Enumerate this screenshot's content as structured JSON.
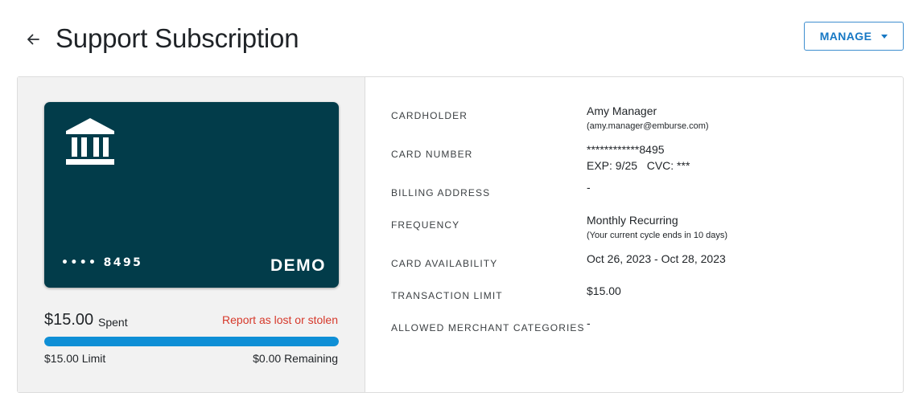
{
  "header": {
    "title": "Support Subscription",
    "back_icon": "arrow-left-icon",
    "manage_label": "MANAGE",
    "manage_icon": "caret-down-icon"
  },
  "card": {
    "number": "•••• 8495",
    "brand": "DEMO",
    "icon": "bank-icon",
    "color": "#023c4a"
  },
  "spend": {
    "amount": "$15.00",
    "spent_label": "Spent",
    "report_link": "Report as lost or stolen",
    "limit_text": "$15.00 Limit",
    "remaining_text": "$0.00 Remaining",
    "progress_fraction": 1.0,
    "progress_color": "#0f8fd6",
    "report_color": "#d6382a"
  },
  "details": {
    "cardholder": {
      "label": "CARDHOLDER",
      "value": "Amy Manager",
      "sub": "(amy.manager@emburse.com)"
    },
    "card_number": {
      "label": "CARD NUMBER",
      "value": "************8495",
      "exp_cvc": "EXP: 9/25   CVC: ***"
    },
    "billing_address": {
      "label": "BILLING ADDRESS",
      "value": "-"
    },
    "frequency": {
      "label": "FREQUENCY",
      "value": "Monthly Recurring",
      "sub": "(Your current cycle ends in 10 days)"
    },
    "card_availability": {
      "label": "CARD AVAILABILITY",
      "value": "Oct 26, 2023 - Oct 28, 2023"
    },
    "transaction_limit": {
      "label": "TRANSACTION LIMIT",
      "value": "$15.00"
    },
    "allowed_merchant_categories": {
      "label": "ALLOWED MERCHANT CATEGORIES",
      "value": "-"
    }
  }
}
